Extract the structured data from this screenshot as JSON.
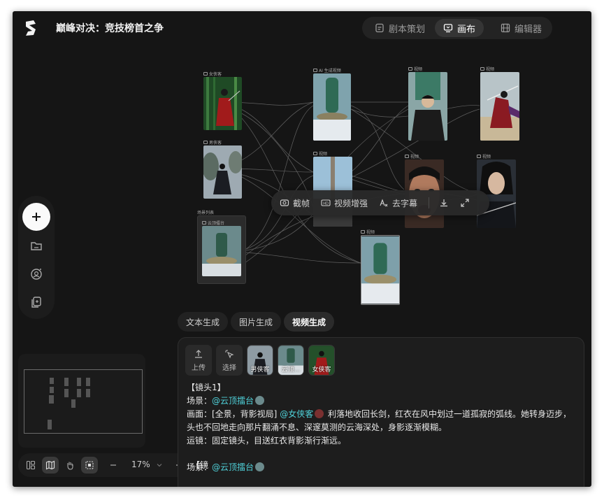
{
  "app": {
    "title": "巅峰对决：竞技榜首之争"
  },
  "header_tabs": [
    {
      "label": "剧本策划",
      "icon": "document-icon"
    },
    {
      "label": "画布",
      "icon": "canvas-icon"
    },
    {
      "label": "编辑器",
      "icon": "film-icon"
    }
  ],
  "left_toolbar": {
    "items": [
      "add-icon",
      "folder-icon",
      "character-icon",
      "duplicate-icon"
    ]
  },
  "bottom_toolbar": {
    "zoom": "17%",
    "items": [
      "layout-icon",
      "map-icon",
      "hand-icon",
      "select-icon",
      "minus-icon",
      "chevron-down-icon",
      "plus-icon",
      "keyboard-icon"
    ]
  },
  "canvas": {
    "nodes": [
      {
        "label": "女侠客",
        "kind": "image"
      },
      {
        "label": "男侠客",
        "kind": "image"
      },
      {
        "label": "场景列表",
        "kind": "group"
      },
      {
        "label": "云顶擂台",
        "kind": "image"
      },
      {
        "label": "AI 生成视频",
        "kind": "video"
      },
      {
        "label": "视频",
        "kind": "video"
      },
      {
        "label": "视频",
        "kind": "video"
      },
      {
        "label": "视频",
        "kind": "video"
      },
      {
        "label": "视频",
        "kind": "video"
      },
      {
        "label": "视频",
        "kind": "video"
      },
      {
        "label": "视频",
        "kind": "video"
      }
    ]
  },
  "floating_toolbar": {
    "items": [
      {
        "label": "截帧",
        "icon": "frame-capture-icon"
      },
      {
        "label": "视频增强",
        "icon": "hd-icon"
      },
      {
        "label": "去字幕",
        "icon": "remove-subtitle-icon"
      }
    ],
    "icons": [
      "download-icon",
      "expand-icon"
    ]
  },
  "gen_tabs": [
    {
      "label": "文本生成"
    },
    {
      "label": "图片生成"
    },
    {
      "label": "视频生成",
      "active": true
    }
  ],
  "panel": {
    "upload_label": "上传",
    "select_label": "选择",
    "refs": [
      "男侠客",
      "云顶...",
      "女侠客"
    ],
    "shot1_title": "【镜头1】",
    "scene_prefix": "场景：",
    "scene_mention": "@云顶擂台",
    "frame_prefix": "画面：[全景，背影视局]",
    "frame_mention": "@女侠客",
    "frame_text": "利落地收回长剑，红衣在风中划过一道孤寂的弧线。她转身迈步，头也不回地走向那片翻涌不息、深邃莫测的云海深处，身影逐渐模糊。",
    "camera_prefix": "运镜：",
    "camera_text": "固定镜头，目送红衣背影渐行渐远。",
    "shot2_title": "【镜",
    "scene2_prefix": "场景：",
    "scene2_mention": "@云顶擂台"
  }
}
